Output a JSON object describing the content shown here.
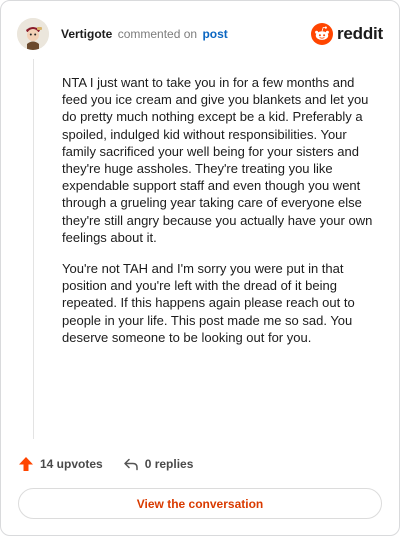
{
  "header": {
    "username": "Vertigote",
    "action_text": "commented on",
    "post_link": "post",
    "brand_name": "reddit"
  },
  "comment": {
    "paragraphs": [
      "NTA I just want to take you in for a few months and feed you ice cream and give you blankets and let you do pretty much nothing except be a kid. Preferably a spoiled, indulged kid without responsibilities. Your family sacrificed your well being for your sisters and they're huge assholes. They're treating you like expendable support staff and even though you went through a grueling year taking care of everyone else they're still angry because you actually have your own feelings about it.",
      "You're not TAH and I'm sorry you were put in that position and you're left with the dread of it being repeated. If this happens again please reach out to people in your life. This post made me so sad. You deserve someone to be looking out for you."
    ]
  },
  "actions": {
    "upvotes": "14 upvotes",
    "replies": "0 replies"
  },
  "cta": {
    "label": "View the conversation"
  },
  "icons": {
    "avatar": "avatar-icon",
    "brand": "reddit-logo-icon",
    "upvote": "upvote-arrow-icon",
    "reply": "reply-arrow-icon"
  },
  "colors": {
    "brand_orange": "#ff4500",
    "link_blue": "#0a66c2",
    "cta_text": "#d93a00",
    "border": "#d9dadc"
  }
}
